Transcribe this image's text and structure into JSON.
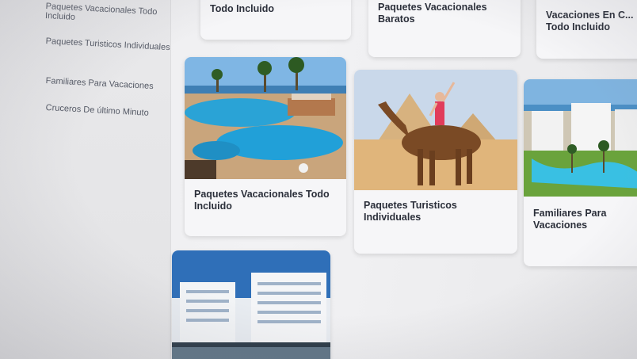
{
  "sidebar": {
    "items": [
      {
        "label": "Paquetes Vacacionales Todo Incluido"
      },
      {
        "label": "Paquetes Turisticos Individuales"
      },
      {
        "label": "Familiares Para Vacaciones"
      },
      {
        "label": "Cruceros De último Minuto"
      }
    ]
  },
  "cards": {
    "top": [
      {
        "title": "Todo Incluido"
      },
      {
        "title": "Paquetes Vacacionales Baratos"
      },
      {
        "title": "Vacaciones En C... Todo Incluido"
      }
    ],
    "middle": [
      {
        "title": "Paquetes Vacacionales Todo Incluido",
        "image": "resort-pool-photo"
      },
      {
        "title": "Paquetes Turisticos Individuales",
        "image": "camel-pyramids-photo"
      },
      {
        "title": "Familiares Para Vacaciones",
        "image": "family-resort-photo"
      }
    ],
    "bottom": [
      {
        "title": "",
        "image": "cruise-ship-photo"
      }
    ]
  }
}
